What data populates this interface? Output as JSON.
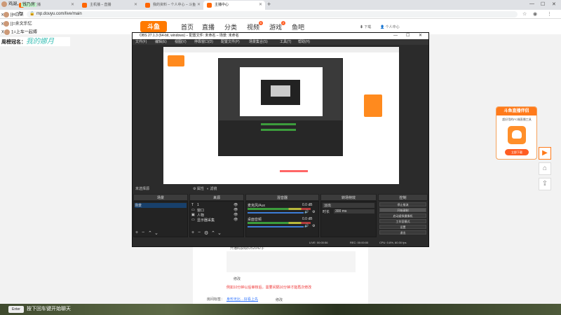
{
  "browser": {
    "tabs": [
      {
        "label": "斗鱼直播"
      },
      {
        "label": "主机播 – 直播"
      },
      {
        "label": "我的资料 – 个人中心 – 斗鱼"
      },
      {
        "label": "主播中心"
      }
    ],
    "url": "mp.douyu.com/live/main"
  },
  "site": {
    "logo": "斗鱼",
    "nav": [
      "首页",
      "直播",
      "分类",
      "视频",
      "游戏",
      "鱼吧"
    ],
    "nav_badges": {
      "video": "6",
      "game": "2"
    },
    "download_label": "下载",
    "user_label": "个人中心"
  },
  "danmu": [
    {
      "prefix": "",
      "name": "鸡湖",
      "suffix": "，",
      "highlight": "钱乃房"
    },
    {
      "prefix": "x",
      "name": "||=白菜",
      "suffix": "",
      "highlight": ""
    },
    {
      "prefix": "x",
      "name": "||=余文乐忆",
      "suffix": "",
      "highlight": ""
    },
    {
      "prefix": "X",
      "name": "1=上车一起搏",
      "suffix": "",
      "highlight": ""
    }
  ],
  "week_name": {
    "label": "周榜冠名：",
    "value": "我的娜月"
  },
  "obs": {
    "title": "OBS 27.1.3 (64-bit, windows) – 配置文件: 未命名 – 场景: 未命名",
    "menu": [
      "文件(F)",
      "编辑(E)",
      "视图(V)",
      "停靠窗口(D)",
      "配置文件(P)",
      "场景集合(S)",
      "工具(T)",
      "帮助(H)"
    ],
    "source_bar": "未选择源",
    "prop_label": "属性",
    "filter_label": "滤镜",
    "docks": [
      "场景",
      "来源",
      "混音器",
      "转场特效",
      "控制"
    ],
    "scenes": [
      "场景"
    ],
    "sources": [
      "1",
      "窗口",
      "人物",
      "显示器采集"
    ],
    "mixer": [
      {
        "name": "麦克风/Aux",
        "db": "0.0 dB"
      },
      {
        "name": "桌面音频",
        "db": "0.0 dB"
      }
    ],
    "transition": {
      "type": "淡出",
      "duration_label": "时长",
      "duration": "300 ms"
    },
    "controls": [
      "停止推流",
      "开始录制",
      "启动虚拟摄像机",
      "工作室模式",
      "设置",
      "退出"
    ],
    "status": {
      "live": "LIVE: 00:00:56",
      "rec": "REC: 00:00:00",
      "cpu": "CPU: 0.8%, 60.00 fps"
    }
  },
  "page": {
    "line1": "开播码获取ID52042子",
    "line2": "修改",
    "red_notice": "例如10分钟以后审核后，需要间隔10分钟才能再次修改",
    "label_tag": "房间标签：",
    "tag_link": "身形无比…好看上先",
    "tag_edit": "修改"
  },
  "promo": {
    "title": "斗鱼直播伴侣",
    "subtitle": "超好用的PC端直播工具",
    "button": "立即下载"
  },
  "chat": {
    "enter_key": "Enter",
    "hint": "按下回车键开始聊天"
  }
}
